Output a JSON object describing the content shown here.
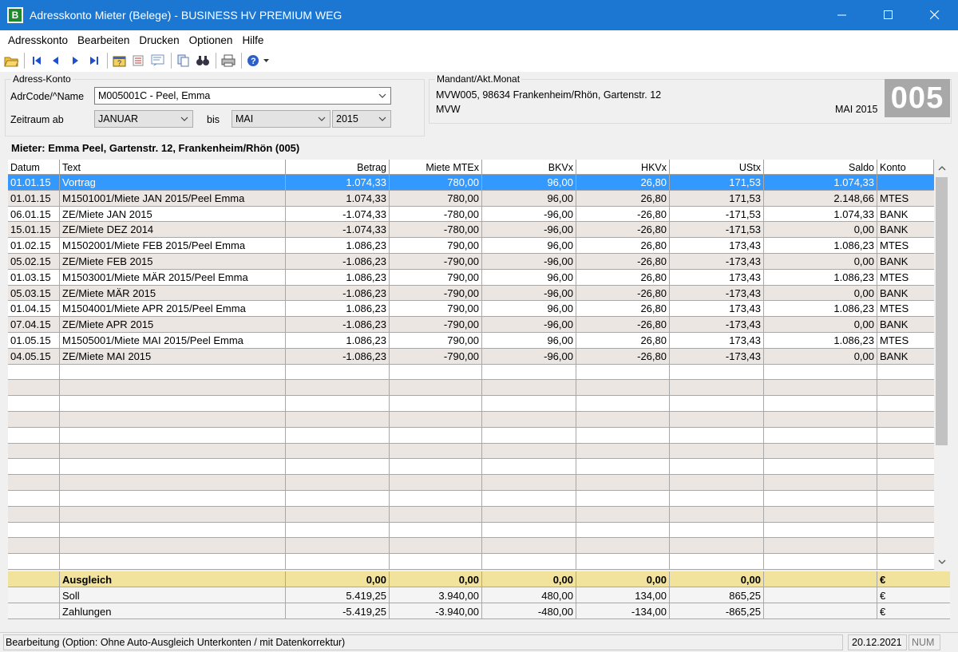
{
  "window": {
    "title": "Adresskonto Mieter (Belege) - BUSINESS HV PREMIUM WEG",
    "icon_text": "B"
  },
  "menu": [
    "Adresskonto",
    "Bearbeiten",
    "Drucken",
    "Optionen",
    "Hilfe"
  ],
  "toolbar_icons": [
    "open-folder-icon",
    "first-record-icon",
    "prev-record-icon",
    "next-record-icon",
    "last-record-icon",
    "edit-icon",
    "sort-icon",
    "filter-icon",
    "copy-icon",
    "find-icon",
    "print-icon",
    "help-icon"
  ],
  "filter": {
    "group_title": "Adress-Konto",
    "adrcode_label": "AdrCode/^Name",
    "adrcode_value": "M005001C - Peel, Emma",
    "zeitraum_label": "Zeitraum ab",
    "from_month": "JANUAR",
    "bis_label": "bis",
    "to_month": "MAI",
    "year": "2015"
  },
  "mandant": {
    "group_title": "Mandant/Akt.Monat",
    "line1": "MVW005, 98634 Frankenheim/Rhön, Gartenstr. 12",
    "line2": "MVW",
    "month": "MAI 2015",
    "number": "005"
  },
  "mieter_heading": "Mieter: Emma Peel, Gartenstr. 12, Frankenheim/Rhön (005)",
  "columns": [
    "Datum",
    "Text",
    "Betrag",
    "Miete MTEx",
    "BKVx",
    "HKVx",
    "UStx",
    "Saldo",
    "Konto"
  ],
  "rows": [
    [
      "01.01.15",
      "Vortrag",
      "1.074,33",
      "780,00",
      "96,00",
      "26,80",
      "171,53",
      "1.074,33",
      ""
    ],
    [
      "01.01.15",
      "M1501001/Miete JAN 2015/Peel Emma",
      "1.074,33",
      "780,00",
      "96,00",
      "26,80",
      "171,53",
      "2.148,66",
      "MTES"
    ],
    [
      "06.01.15",
      "ZE/Miete JAN 2015",
      "-1.074,33",
      "-780,00",
      "-96,00",
      "-26,80",
      "-171,53",
      "1.074,33",
      "BANK"
    ],
    [
      "15.01.15",
      "ZE/Miete DEZ 2014",
      "-1.074,33",
      "-780,00",
      "-96,00",
      "-26,80",
      "-171,53",
      "0,00",
      "BANK"
    ],
    [
      "01.02.15",
      "M1502001/Miete FEB 2015/Peel Emma",
      "1.086,23",
      "790,00",
      "96,00",
      "26,80",
      "173,43",
      "1.086,23",
      "MTES"
    ],
    [
      "05.02.15",
      "ZE/Miete FEB 2015",
      "-1.086,23",
      "-790,00",
      "-96,00",
      "-26,80",
      "-173,43",
      "0,00",
      "BANK"
    ],
    [
      "01.03.15",
      "M1503001/Miete MÄR 2015/Peel Emma",
      "1.086,23",
      "790,00",
      "96,00",
      "26,80",
      "173,43",
      "1.086,23",
      "MTES"
    ],
    [
      "05.03.15",
      "ZE/Miete MÄR 2015",
      "-1.086,23",
      "-790,00",
      "-96,00",
      "-26,80",
      "-173,43",
      "0,00",
      "BANK"
    ],
    [
      "01.04.15",
      "M1504001/Miete APR 2015/Peel Emma",
      "1.086,23",
      "790,00",
      "96,00",
      "26,80",
      "173,43",
      "1.086,23",
      "MTES"
    ],
    [
      "07.04.15",
      "ZE/Miete APR 2015",
      "-1.086,23",
      "-790,00",
      "-96,00",
      "-26,80",
      "-173,43",
      "0,00",
      "BANK"
    ],
    [
      "01.05.15",
      "M1505001/Miete MAI 2015/Peel Emma",
      "1.086,23",
      "790,00",
      "96,00",
      "26,80",
      "173,43",
      "1.086,23",
      "MTES"
    ],
    [
      "04.05.15",
      "ZE/Miete MAI 2015",
      "-1.086,23",
      "-790,00",
      "-96,00",
      "-26,80",
      "-173,43",
      "0,00",
      "BANK"
    ]
  ],
  "selected_row": 0,
  "totals": [
    [
      "Ausgleich",
      "0,00",
      "0,00",
      "0,00",
      "0,00",
      "0,00",
      "",
      "€"
    ],
    [
      "Soll",
      "5.419,25",
      "3.940,00",
      "480,00",
      "134,00",
      "865,25",
      "",
      "€"
    ],
    [
      "Zahlungen",
      "-5.419,25",
      "-3.940,00",
      "-480,00",
      "-134,00",
      "-865,25",
      "",
      "€"
    ]
  ],
  "status": {
    "text": "Bearbeitung (Option: Ohne Auto-Ausgleich Unterkonten / mit Datenkorrektur)",
    "date": "20.12.2021",
    "num": "NUM"
  },
  "colors": {
    "titlebar": "#1c77d2",
    "selection": "#3399ff",
    "row_alt": "#ebe6e2",
    "totals_gold": "#f1e39c"
  }
}
